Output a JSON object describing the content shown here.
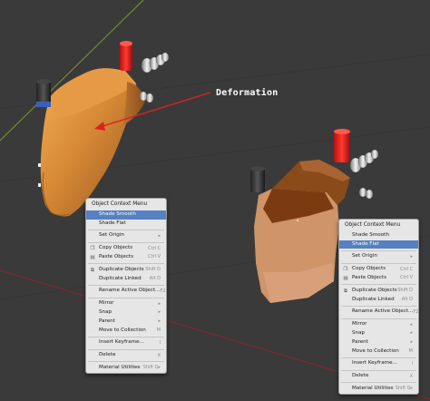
{
  "annotation": "Deformation",
  "menu_left": {
    "title": "Object Context Menu",
    "highlighted_index": 0,
    "groups": [
      [
        {
          "label": "Shade Smooth",
          "shortcut": ""
        },
        {
          "label": "Shade Flat",
          "shortcut": ""
        }
      ],
      [
        {
          "label": "Set Origin",
          "shortcut": "▸"
        }
      ],
      [
        {
          "label": "Copy Objects",
          "shortcut": "Ctrl C",
          "icon": "copy-icon"
        },
        {
          "label": "Paste Objects",
          "shortcut": "Ctrl V",
          "icon": "paste-icon"
        }
      ],
      [
        {
          "label": "Duplicate Objects",
          "shortcut": "Shift D",
          "icon": "duplicate-icon"
        },
        {
          "label": "Duplicate Linked",
          "shortcut": "Alt D"
        }
      ],
      [
        {
          "label": "Rename Active Object...",
          "shortcut": "F2"
        }
      ],
      [
        {
          "label": "Mirror",
          "shortcut": "▸"
        },
        {
          "label": "Snap",
          "shortcut": "▸"
        },
        {
          "label": "Parent",
          "shortcut": "▸"
        },
        {
          "label": "Move to Collection",
          "shortcut": "M"
        }
      ],
      [
        {
          "label": "Insert Keyframe...",
          "shortcut": "I"
        }
      ],
      [
        {
          "label": "Delete",
          "shortcut": "X"
        }
      ],
      [
        {
          "label": "Material Utilities",
          "shortcut": "Shift Q▸"
        }
      ]
    ]
  },
  "menu_right": {
    "title": "Object Context Menu",
    "highlighted_index": 1,
    "groups": [
      [
        {
          "label": "Shade Smooth",
          "shortcut": ""
        },
        {
          "label": "Shade Flat",
          "shortcut": ""
        }
      ],
      [
        {
          "label": "Set Origin",
          "shortcut": "▸"
        }
      ],
      [
        {
          "label": "Copy Objects",
          "shortcut": "Ctrl C",
          "icon": "copy-icon"
        },
        {
          "label": "Paste Objects",
          "shortcut": "Ctrl V",
          "icon": "paste-icon"
        }
      ],
      [
        {
          "label": "Duplicate Objects",
          "shortcut": "Shift D",
          "icon": "duplicate-icon"
        },
        {
          "label": "Duplicate Linked",
          "shortcut": "Alt D"
        }
      ],
      [
        {
          "label": "Rename Active Object...",
          "shortcut": "F2"
        }
      ],
      [
        {
          "label": "Mirror",
          "shortcut": "▸"
        },
        {
          "label": "Snap",
          "shortcut": "▸"
        },
        {
          "label": "Parent",
          "shortcut": "▸"
        },
        {
          "label": "Move to Collection",
          "shortcut": "M"
        }
      ],
      [
        {
          "label": "Insert Keyframe...",
          "shortcut": "I"
        }
      ],
      [
        {
          "label": "Delete",
          "shortcut": "X"
        }
      ],
      [
        {
          "label": "Material Utilities",
          "shortcut": "Shift Q▸"
        }
      ]
    ]
  },
  "colors": {
    "viewport_bg": "#3a3a3a",
    "grid_line": "#2f2f2f",
    "x_axis": "#9b2a36",
    "y_axis": "#6e8f25",
    "highlight": "#5680c2",
    "arrow": "#e02020",
    "smooth_body": "#d08a3c",
    "flat_body": "#c98a5c"
  }
}
